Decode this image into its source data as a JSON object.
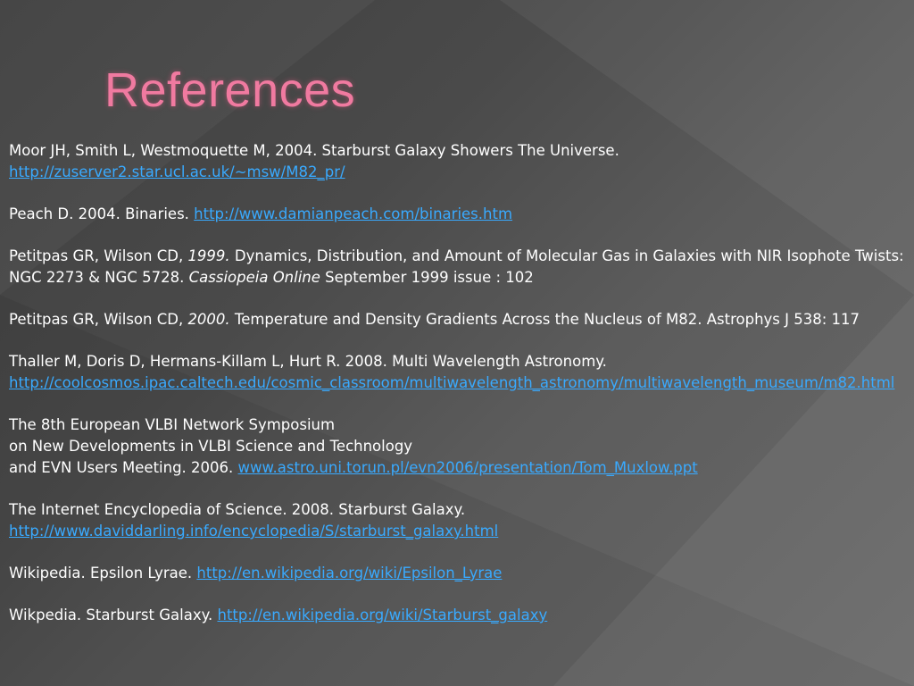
{
  "slide": {
    "title": "References"
  },
  "references": [
    {
      "text": "Moor JH, Smith L, Westmoquette M, 2004. Starburst Galaxy Showers The Universe.",
      "link": "http://zuserver2.star.ucl.ac.uk/~msw/M82_pr/"
    },
    {
      "text": "Peach D. 2004. Binaries. ",
      "link": "http://www.damianpeach.com/binaries.htm"
    },
    {
      "a": "Petitpas GR, Wilson CD, ",
      "year": "1999.",
      "b": " Dynamics, Distribution, and Amount of Molecular Gas in Galaxies with NIR Isophote Twists: NGC 2273 & NGC 5728. ",
      "journal": "Cassiopeia Online",
      "c": " September 1999 issue : 102"
    },
    {
      "a": "Petitpas GR, Wilson CD, ",
      "year": "2000.",
      "b": " Temperature and Density Gradients Across the Nucleus of M82. Astrophys J 538: 117"
    },
    {
      "text": "Thaller M, Doris D, Hermans-Killam L, Hurt R. 2008. Multi Wavelength Astronomy.",
      "link": "http://coolcosmos.ipac.caltech.edu/cosmic_classroom/multiwavelength_astronomy/multiwavelength_museum/m82.html"
    },
    {
      "line1": "The 8th European VLBI Network Symposium",
      "line2": "on New Developments in VLBI Science and Technology",
      "line3": "and EVN Users Meeting. 2006. ",
      "link": "www.astro.uni.torun.pl/evn2006/presentation/Tom_Muxlow.ppt"
    },
    {
      "text": "The Internet Encyclopedia of Science. 2008. Starburst Galaxy.",
      "link": "http://www.daviddarling.info/encyclopedia/S/starburst_galaxy.html"
    },
    {
      "text": "Wikipedia. Epsilon Lyrae. ",
      "link": "http://en.wikipedia.org/wiki/Epsilon_Lyrae"
    },
    {
      "text": "Wikpedia. Starburst Galaxy. ",
      "link": "http://en.wikipedia.org/wiki/Starburst_galaxy"
    }
  ],
  "colors": {
    "title": "#f07aa0",
    "text": "#ffffff",
    "link": "#39aaff",
    "background": "#4a4a4a"
  }
}
